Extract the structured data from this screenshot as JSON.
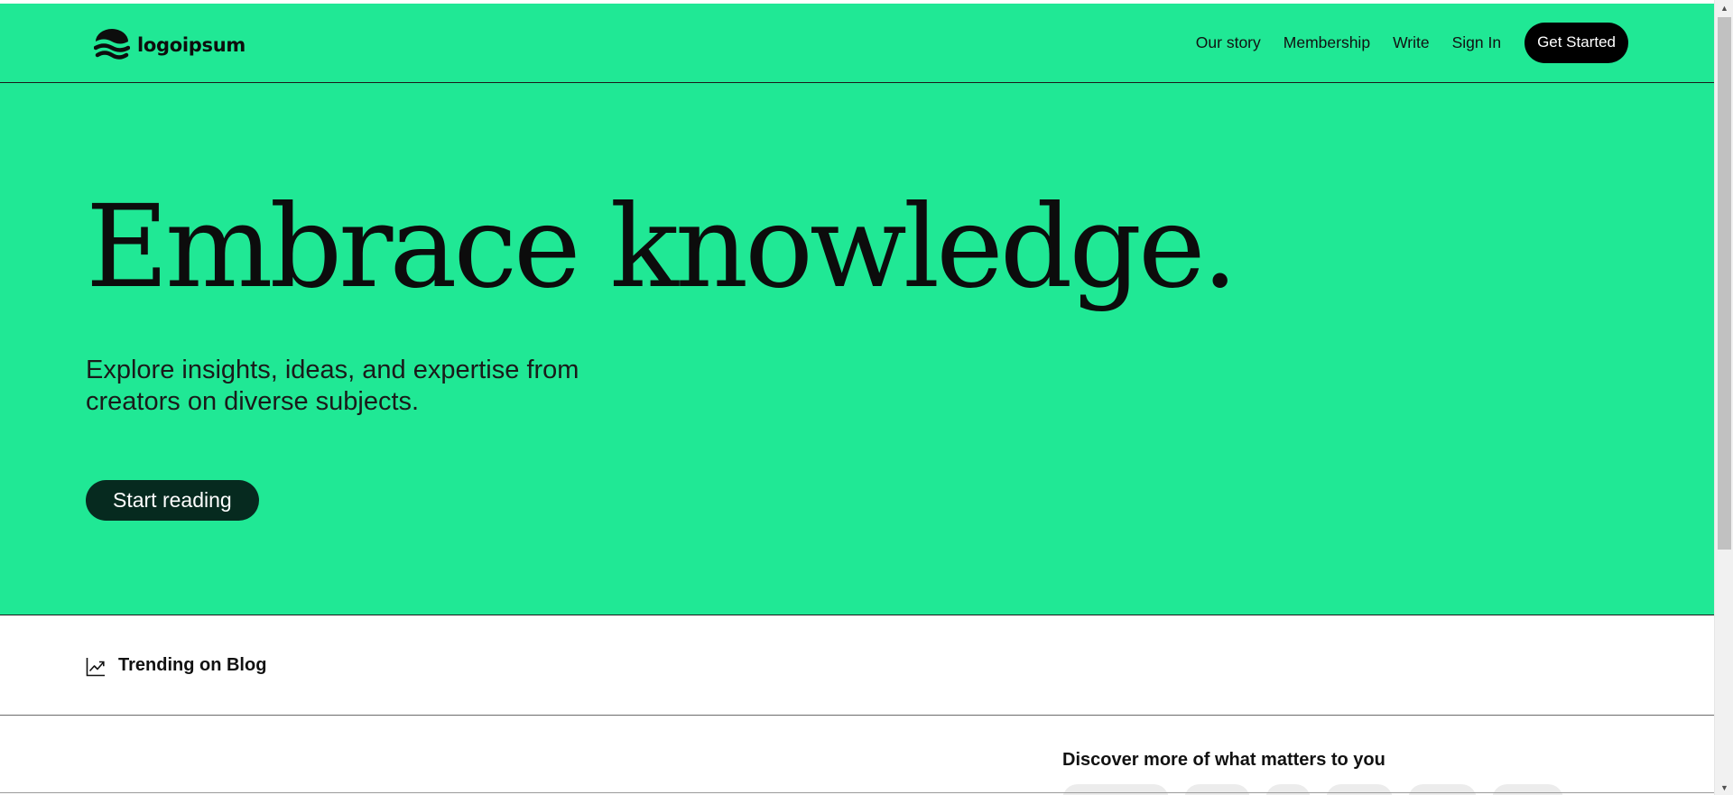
{
  "header": {
    "logo_text": "logoipsum",
    "logo_icon": "waves-logo-icon",
    "nav": [
      {
        "label": "Our story"
      },
      {
        "label": "Membership"
      },
      {
        "label": "Write"
      },
      {
        "label": "Sign In"
      }
    ],
    "cta_label": "Get Started"
  },
  "hero": {
    "title": "Embrace knowledge.",
    "subtitle": "Explore insights, ideas, and expertise from creators on diverse subjects.",
    "button_label": "Start reading"
  },
  "trending": {
    "icon": "trending-up-icon",
    "label": "Trending on Blog"
  },
  "discover": {
    "title": "Discover more of what matters to you",
    "chip_count_visible": 6
  },
  "colors": {
    "brand_green": "#20e895",
    "cta_black": "#000000",
    "start_reading_bg": "#062a1f",
    "chip_bg": "#ececec"
  }
}
